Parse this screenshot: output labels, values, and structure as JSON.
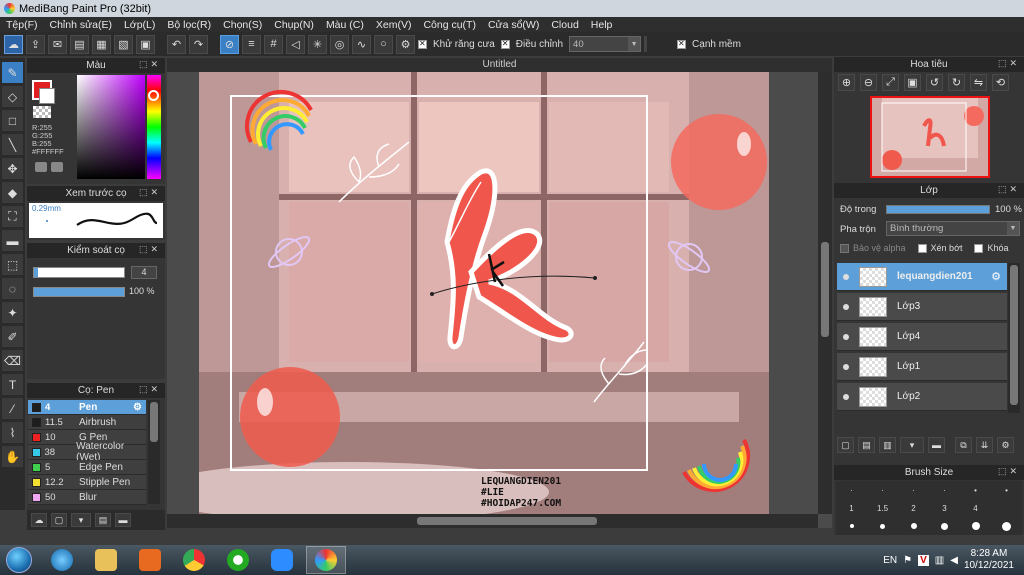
{
  "window": {
    "title": "MediBang Paint Pro (32bit)"
  },
  "menu": [
    "Tệp(F)",
    "Chỉnh sửa(E)",
    "Lớp(L)",
    "Bộ lọc(R)",
    "Chọn(S)",
    "Chụp(N)",
    "Màu (C)",
    "Xem(V)",
    "Công cụ(T)",
    "Cửa sổ(W)",
    "Cloud",
    "Help"
  ],
  "toolbar": {
    "antialias_label": "Khử răng cưa",
    "adjust_label": "Điều chỉnh",
    "adjust_value": "40",
    "edge_label": "Cạnh mềm"
  },
  "color_panel": {
    "title": "Màu",
    "r": "R:255",
    "g": "G:255",
    "b": "B:255",
    "hex": "#FFFFFF"
  },
  "brush_preview": {
    "title": "Xem trước cọ",
    "size": "0.29mm"
  },
  "brush_control": {
    "title": "Kiểm soát cọ",
    "size_value": "4",
    "opacity_value": "100 %"
  },
  "brushes": {
    "title": "Cọ: Pen",
    "items": [
      {
        "size": "4",
        "name": "Pen",
        "color": "#1e1e1e",
        "selected": true
      },
      {
        "size": "11.5",
        "name": "Airbrush",
        "color": "#1e1e1e",
        "selected": false
      },
      {
        "size": "10",
        "name": "G Pen",
        "color": "#ee2222",
        "selected": false
      },
      {
        "size": "38",
        "name": "Watercolor (Wet)",
        "color": "#35c8e8",
        "selected": false
      },
      {
        "size": "5",
        "name": "Edge Pen",
        "color": "#3fd04f",
        "selected": false
      },
      {
        "size": "12.2",
        "name": "Stipple Pen",
        "color": "#f4e030",
        "selected": false
      },
      {
        "size": "50",
        "name": "Blur",
        "color": "#f0a6f0",
        "selected": false
      }
    ]
  },
  "document": {
    "tab_title": "Untitled",
    "signature": [
      "LEQUANGDIEN201",
      "#LIE",
      "#HOIDAP247.COM"
    ]
  },
  "navigator": {
    "title": "Hoa tiêu"
  },
  "layers": {
    "title": "Lớp",
    "opacity_label": "Độ trong",
    "opacity_value": "100 %",
    "blend_label": "Pha trộn",
    "blend_value": "Bình thường",
    "protect_alpha": "Bảo vệ alpha",
    "clipping": "Xén bớt",
    "lock": "Khóa",
    "items": [
      {
        "name": "lequangdien201",
        "selected": true
      },
      {
        "name": "Lớp3",
        "selected": false
      },
      {
        "name": "Lớp4",
        "selected": false
      },
      {
        "name": "Lớp1",
        "selected": false
      },
      {
        "name": "Lớp2",
        "selected": false
      }
    ]
  },
  "brush_size_panel": {
    "title": "Brush Size",
    "labels": [
      "1",
      "1.5",
      "2",
      "3",
      "4"
    ]
  },
  "taskbar": {
    "lang": "EN",
    "time": "8:28 AM",
    "date": "10/12/2021"
  },
  "colors": {
    "accent": "#5d9fd8",
    "letter": "#f0564c"
  }
}
